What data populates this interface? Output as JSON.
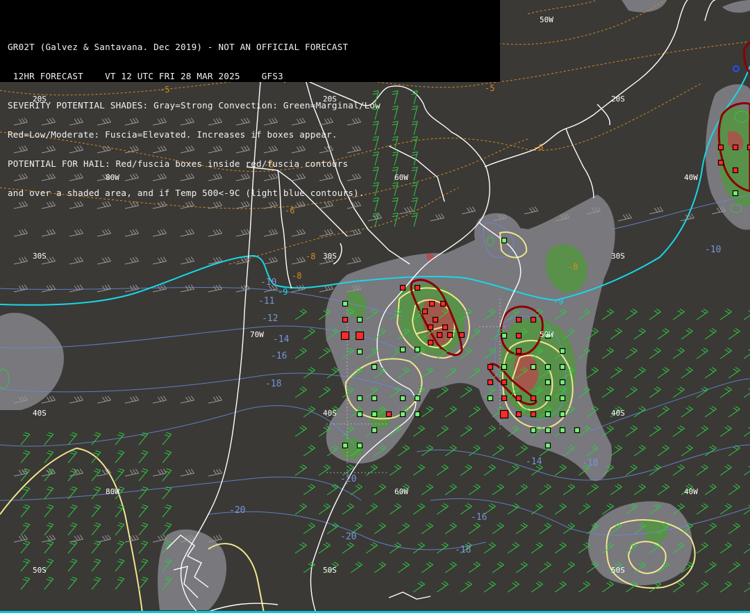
{
  "header": {
    "lines": [
      "GR02T (Galvez & Santavana. Dec 2019) - NOT AN OFFICIAL FORECAST",
      " 12HR FORECAST    VT 12 UTC FRI 28 MAR 2025    GFS3",
      "SEVERITY POTENTIAL SHADES: Gray=Strong Convection: Green=Marginal/Low",
      "Red=Low/Moderate: Fuscia=Elevated. Increases if boxes appear.",
      "POTENTIAL FOR HAIL: Red/fuscia boxes inside red/fuscia contours",
      "and over a shaded area, and if Temp 500<-9C (light blue contours)."
    ]
  },
  "grid_labels": [
    {
      "text": "50W"
    },
    {
      "text": "20S"
    },
    {
      "text": "20S"
    },
    {
      "text": "20S"
    },
    {
      "text": "80W"
    },
    {
      "text": "60W"
    },
    {
      "text": "40W"
    },
    {
      "text": "30S"
    },
    {
      "text": "30S"
    },
    {
      "text": "30S"
    },
    {
      "text": "70W"
    },
    {
      "text": "50W"
    },
    {
      "text": "40S"
    },
    {
      "text": "40S"
    },
    {
      "text": "40S"
    },
    {
      "text": "80W"
    },
    {
      "text": "60W"
    },
    {
      "text": "40W"
    },
    {
      "text": "50S"
    },
    {
      "text": "50S"
    },
    {
      "text": "50S"
    }
  ],
  "contour_labels": {
    "orange": [
      "-5",
      "-5",
      "-6",
      "-6",
      "-6",
      "-8",
      "-8",
      "-8"
    ],
    "cyan": [
      "-9",
      "-9"
    ],
    "blue": [
      "-10",
      "-10",
      "-11",
      "-12",
      "-14",
      "-16",
      "-18",
      "-20",
      "-20",
      "-20",
      "-14",
      "-18",
      "-16",
      "-18"
    ]
  },
  "colors": {
    "background": "#3a3936",
    "header_bg": "#000000",
    "coastline": "#ffffff",
    "temp_contour_orange": "#d98a1c",
    "freezing_line_cyan": "#18d8e8",
    "temp_contour_blue": "#6a8ad8",
    "strong_convection_gray": "#8d8e96",
    "marginal_green": "#4f9a3a",
    "moderate_red": "#b44a4a",
    "yellow_contour": "#f0e68c",
    "red_contour": "#8b0000",
    "wind_barb_green": "#2ecc40",
    "wind_barb_gray": "#9a9a9a"
  }
}
